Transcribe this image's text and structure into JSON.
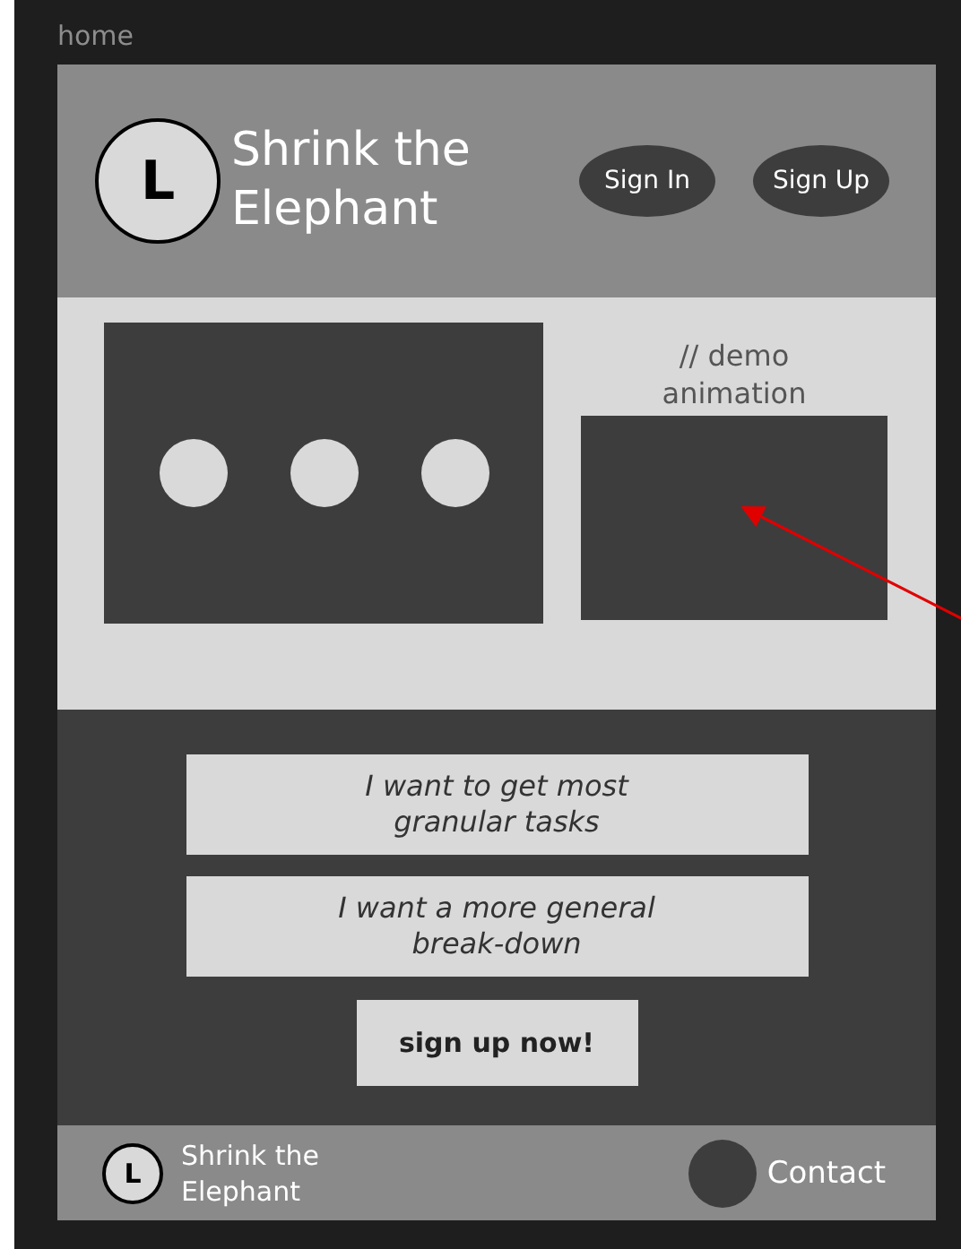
{
  "frame_label": "home",
  "header": {
    "logo_letter": "L",
    "title": "Shrink the Elephant",
    "buttons": [
      "Sign In",
      "Sign Up"
    ]
  },
  "hero": {
    "demo_label": "// demo animation"
  },
  "options": [
    "I want to get most granular tasks",
    "I want a more general break-down"
  ],
  "cta": "sign up now!",
  "footer": {
    "logo_letter": "L",
    "title": "Shrink the Elephant",
    "link": "Contact"
  }
}
